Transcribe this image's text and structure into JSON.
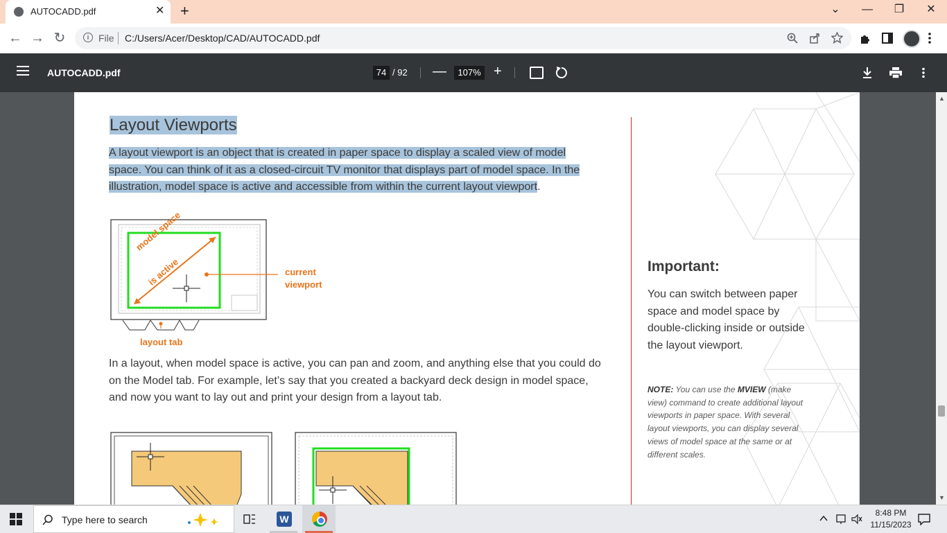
{
  "browser": {
    "tab_title": "AUTOCADD.pdf",
    "tab_close": "✕",
    "new_tab": "+",
    "window_controls": [
      "⌄",
      "—",
      "❐",
      "✕"
    ],
    "scheme_label": "File",
    "url": "C:/Users/Acer/Desktop/CAD/AUTOCADD.pdf",
    "back": "←",
    "forward": "→",
    "reload": "↻"
  },
  "pdf_toolbar": {
    "title": "AUTOCADD.pdf",
    "current_page": "74",
    "total_pages": "/ 92",
    "zoom": "107%",
    "zoom_out": "—",
    "zoom_in": "+"
  },
  "document": {
    "heading": "Layout Viewports",
    "intro_lines": [
      "A layout viewport is an object that is created in paper space to display a scaled view of model",
      "space. You can think of it as a closed-circuit TV monitor that displays part of model space. In the",
      "illustration, model space is active and accessible from within the current layout viewport"
    ],
    "intro_period": ".",
    "figure1": {
      "label_model": "model space",
      "label_active": "is active",
      "label_current": "current",
      "label_viewport": "viewport",
      "label_tab": "layout tab"
    },
    "para2": "In a layout, when model space is active, you can pan and zoom, and anything else that you could do on the Model tab. For example, let’s say that you created a backyard deck design in model space, and now you want to lay out and print your design from a layout tab.",
    "important_title": "Important:",
    "important_body": "You can switch between paper space and model space by double-clicking inside or outside the layout viewport.",
    "note_label": "NOTE:",
    "note_text_1": " You can use the ",
    "note_cmd": "MVIEW",
    "note_text_2": " (make view) command to create additional layout viewports in paper space. With several layout viewports, you can display several views of model space at the same or at different scales."
  },
  "taskbar": {
    "search_placeholder": "Type here to search",
    "time": "8:48 PM",
    "date": "11/15/2023"
  },
  "colors": {
    "highlight": "#a8c4dc",
    "accent_red": "#d2232a",
    "annotation_orange": "#e8751a",
    "viewport_green": "#22dd22",
    "deck_fill": "#f5c97a"
  }
}
